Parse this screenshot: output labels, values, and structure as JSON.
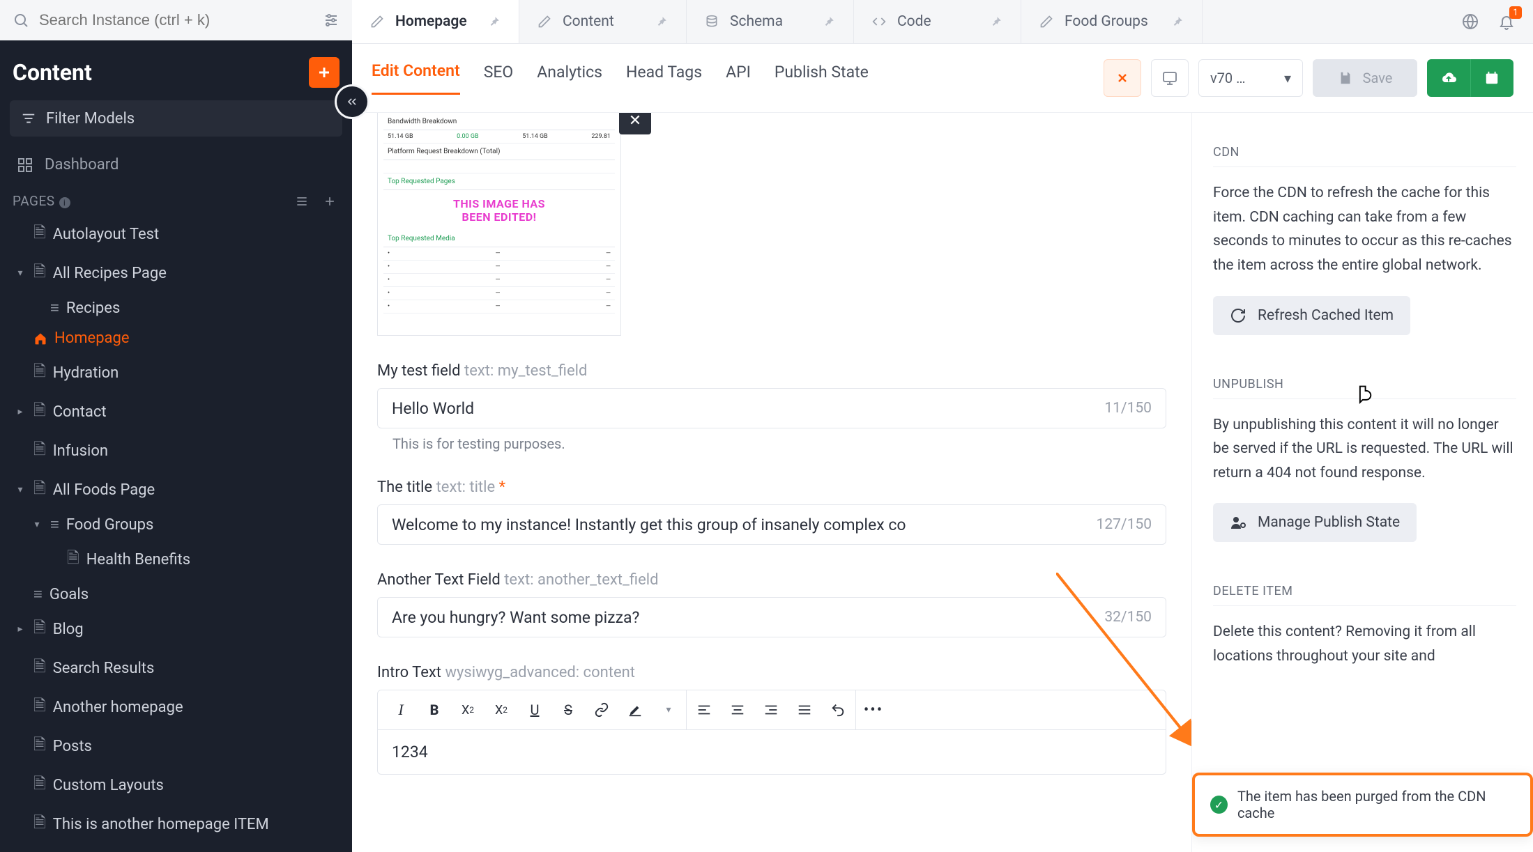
{
  "search": {
    "placeholder": "Search Instance (ctrl + k)"
  },
  "sidebar": {
    "title": "Content",
    "filter_label": "Filter Models",
    "dashboard_label": "Dashboard",
    "pages_label": "PAGES",
    "items": [
      {
        "label": "Autolayout Test"
      },
      {
        "label": "All Recipes Page"
      },
      {
        "label": "Recipes"
      },
      {
        "label": "Homepage"
      },
      {
        "label": "Hydration"
      },
      {
        "label": "Contact"
      },
      {
        "label": "Infusion"
      },
      {
        "label": "All Foods Page"
      },
      {
        "label": "Food Groups"
      },
      {
        "label": "Health Benefits"
      },
      {
        "label": "Goals"
      },
      {
        "label": "Blog"
      },
      {
        "label": "Search Results"
      },
      {
        "label": "Another homepage"
      },
      {
        "label": "Posts"
      },
      {
        "label": "Custom Layouts"
      },
      {
        "label": "This is another homepage ITEM"
      }
    ]
  },
  "tabs": [
    {
      "label": "Homepage",
      "icon": "pencil"
    },
    {
      "label": "Content",
      "icon": "pencil"
    },
    {
      "label": "Schema",
      "icon": "database"
    },
    {
      "label": "Code",
      "icon": "code"
    },
    {
      "label": "Food Groups",
      "icon": "pencil"
    }
  ],
  "notif_badge": "1",
  "subnav": {
    "tabs": [
      "Edit Content",
      "SEO",
      "Analytics",
      "Head Tags",
      "API",
      "Publish State"
    ],
    "version": "v70 …",
    "save_label": "Save"
  },
  "thumb": {
    "heads": [
      "Bandwidth Breakdown",
      "Platform Request Breakdown (Total)",
      "Top Requested Pages",
      "Top Requested Media"
    ],
    "banner1": "THIS IMAGE HAS",
    "banner2": "BEEN EDITED!",
    "bw_row": [
      "51.14 GB",
      "0.00 GB",
      "51.14 GB",
      "229.81"
    ]
  },
  "fields": {
    "f1": {
      "label": "My test field",
      "meta": "text: my_test_field",
      "value": "Hello World",
      "count": "11/150",
      "help": "This is for testing purposes."
    },
    "f2": {
      "label": "The title",
      "meta": "text: title",
      "value": "Welcome to my instance! Instantly get this group of insanely complex co",
      "count": "127/150"
    },
    "f3": {
      "label": "Another Text Field",
      "meta": "text: another_text_field",
      "value": "Are you hungry? Want some pizza?",
      "count": "32/150"
    },
    "f4": {
      "label": "Intro Text",
      "meta": "wysiwyg_advanced: content",
      "value": "1234"
    }
  },
  "right": {
    "cdn_title": "CDN",
    "cdn_text": "Force the CDN to refresh the cache for this item. CDN caching can take from a few seconds to minutes to occur as this re-caches the item across the entire global network.",
    "refresh_label": "Refresh Cached Item",
    "unpub_title": "UNPUBLISH",
    "unpub_text": "By unpublishing this content it will no longer be served if the URL is requested. The URL will return a 404 not found response.",
    "manage_label": "Manage Publish State",
    "delete_title": "DELETE ITEM",
    "delete_text": "Delete this content? Removing it from all locations throughout your site and"
  },
  "toast": {
    "text": "The item has been purged from the CDN cache"
  }
}
